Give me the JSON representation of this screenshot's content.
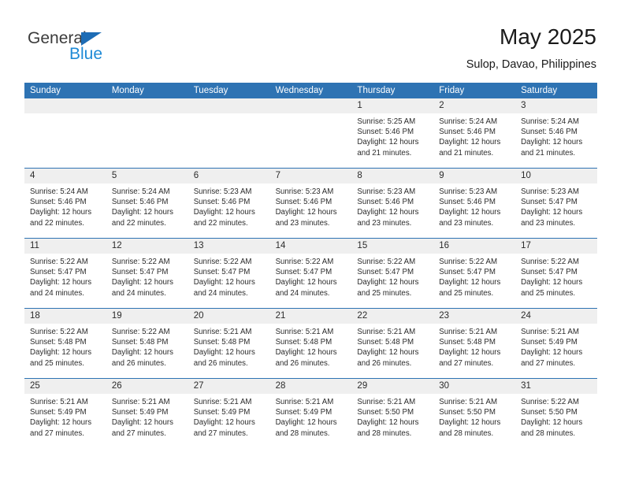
{
  "brand": {
    "name_part1": "General",
    "name_part2": "Blue",
    "triangle_color": "#1d6cb5",
    "blue_color": "#1e8ad6"
  },
  "header": {
    "title": "May 2025",
    "subtitle": "Sulop, Davao, Philippines"
  },
  "colors": {
    "header_blue": "#2e73b3",
    "day_number_bg": "#efefef",
    "text": "#2b2b2b"
  },
  "weekdays": [
    "Sunday",
    "Monday",
    "Tuesday",
    "Wednesday",
    "Thursday",
    "Friday",
    "Saturday"
  ],
  "labels": {
    "sunrise": "Sunrise:",
    "sunset": "Sunset:",
    "daylight": "Daylight:"
  },
  "weeks": [
    [
      {
        "day": "",
        "empty": true
      },
      {
        "day": "",
        "empty": true
      },
      {
        "day": "",
        "empty": true
      },
      {
        "day": "",
        "empty": true
      },
      {
        "day": "1",
        "sunrise": "Sunrise: 5:25 AM",
        "sunset": "Sunset: 5:46 PM",
        "daylight_line1": "Daylight: 12 hours",
        "daylight_line2": "and 21 minutes."
      },
      {
        "day": "2",
        "sunrise": "Sunrise: 5:24 AM",
        "sunset": "Sunset: 5:46 PM",
        "daylight_line1": "Daylight: 12 hours",
        "daylight_line2": "and 21 minutes."
      },
      {
        "day": "3",
        "sunrise": "Sunrise: 5:24 AM",
        "sunset": "Sunset: 5:46 PM",
        "daylight_line1": "Daylight: 12 hours",
        "daylight_line2": "and 21 minutes."
      }
    ],
    [
      {
        "day": "4",
        "sunrise": "Sunrise: 5:24 AM",
        "sunset": "Sunset: 5:46 PM",
        "daylight_line1": "Daylight: 12 hours",
        "daylight_line2": "and 22 minutes."
      },
      {
        "day": "5",
        "sunrise": "Sunrise: 5:24 AM",
        "sunset": "Sunset: 5:46 PM",
        "daylight_line1": "Daylight: 12 hours",
        "daylight_line2": "and 22 minutes."
      },
      {
        "day": "6",
        "sunrise": "Sunrise: 5:23 AM",
        "sunset": "Sunset: 5:46 PM",
        "daylight_line1": "Daylight: 12 hours",
        "daylight_line2": "and 22 minutes."
      },
      {
        "day": "7",
        "sunrise": "Sunrise: 5:23 AM",
        "sunset": "Sunset: 5:46 PM",
        "daylight_line1": "Daylight: 12 hours",
        "daylight_line2": "and 23 minutes."
      },
      {
        "day": "8",
        "sunrise": "Sunrise: 5:23 AM",
        "sunset": "Sunset: 5:46 PM",
        "daylight_line1": "Daylight: 12 hours",
        "daylight_line2": "and 23 minutes."
      },
      {
        "day": "9",
        "sunrise": "Sunrise: 5:23 AM",
        "sunset": "Sunset: 5:46 PM",
        "daylight_line1": "Daylight: 12 hours",
        "daylight_line2": "and 23 minutes."
      },
      {
        "day": "10",
        "sunrise": "Sunrise: 5:23 AM",
        "sunset": "Sunset: 5:47 PM",
        "daylight_line1": "Daylight: 12 hours",
        "daylight_line2": "and 23 minutes."
      }
    ],
    [
      {
        "day": "11",
        "sunrise": "Sunrise: 5:22 AM",
        "sunset": "Sunset: 5:47 PM",
        "daylight_line1": "Daylight: 12 hours",
        "daylight_line2": "and 24 minutes."
      },
      {
        "day": "12",
        "sunrise": "Sunrise: 5:22 AM",
        "sunset": "Sunset: 5:47 PM",
        "daylight_line1": "Daylight: 12 hours",
        "daylight_line2": "and 24 minutes."
      },
      {
        "day": "13",
        "sunrise": "Sunrise: 5:22 AM",
        "sunset": "Sunset: 5:47 PM",
        "daylight_line1": "Daylight: 12 hours",
        "daylight_line2": "and 24 minutes."
      },
      {
        "day": "14",
        "sunrise": "Sunrise: 5:22 AM",
        "sunset": "Sunset: 5:47 PM",
        "daylight_line1": "Daylight: 12 hours",
        "daylight_line2": "and 24 minutes."
      },
      {
        "day": "15",
        "sunrise": "Sunrise: 5:22 AM",
        "sunset": "Sunset: 5:47 PM",
        "daylight_line1": "Daylight: 12 hours",
        "daylight_line2": "and 25 minutes."
      },
      {
        "day": "16",
        "sunrise": "Sunrise: 5:22 AM",
        "sunset": "Sunset: 5:47 PM",
        "daylight_line1": "Daylight: 12 hours",
        "daylight_line2": "and 25 minutes."
      },
      {
        "day": "17",
        "sunrise": "Sunrise: 5:22 AM",
        "sunset": "Sunset: 5:47 PM",
        "daylight_line1": "Daylight: 12 hours",
        "daylight_line2": "and 25 minutes."
      }
    ],
    [
      {
        "day": "18",
        "sunrise": "Sunrise: 5:22 AM",
        "sunset": "Sunset: 5:48 PM",
        "daylight_line1": "Daylight: 12 hours",
        "daylight_line2": "and 25 minutes."
      },
      {
        "day": "19",
        "sunrise": "Sunrise: 5:22 AM",
        "sunset": "Sunset: 5:48 PM",
        "daylight_line1": "Daylight: 12 hours",
        "daylight_line2": "and 26 minutes."
      },
      {
        "day": "20",
        "sunrise": "Sunrise: 5:21 AM",
        "sunset": "Sunset: 5:48 PM",
        "daylight_line1": "Daylight: 12 hours",
        "daylight_line2": "and 26 minutes."
      },
      {
        "day": "21",
        "sunrise": "Sunrise: 5:21 AM",
        "sunset": "Sunset: 5:48 PM",
        "daylight_line1": "Daylight: 12 hours",
        "daylight_line2": "and 26 minutes."
      },
      {
        "day": "22",
        "sunrise": "Sunrise: 5:21 AM",
        "sunset": "Sunset: 5:48 PM",
        "daylight_line1": "Daylight: 12 hours",
        "daylight_line2": "and 26 minutes."
      },
      {
        "day": "23",
        "sunrise": "Sunrise: 5:21 AM",
        "sunset": "Sunset: 5:48 PM",
        "daylight_line1": "Daylight: 12 hours",
        "daylight_line2": "and 27 minutes."
      },
      {
        "day": "24",
        "sunrise": "Sunrise: 5:21 AM",
        "sunset": "Sunset: 5:49 PM",
        "daylight_line1": "Daylight: 12 hours",
        "daylight_line2": "and 27 minutes."
      }
    ],
    [
      {
        "day": "25",
        "sunrise": "Sunrise: 5:21 AM",
        "sunset": "Sunset: 5:49 PM",
        "daylight_line1": "Daylight: 12 hours",
        "daylight_line2": "and 27 minutes."
      },
      {
        "day": "26",
        "sunrise": "Sunrise: 5:21 AM",
        "sunset": "Sunset: 5:49 PM",
        "daylight_line1": "Daylight: 12 hours",
        "daylight_line2": "and 27 minutes."
      },
      {
        "day": "27",
        "sunrise": "Sunrise: 5:21 AM",
        "sunset": "Sunset: 5:49 PM",
        "daylight_line1": "Daylight: 12 hours",
        "daylight_line2": "and 27 minutes."
      },
      {
        "day": "28",
        "sunrise": "Sunrise: 5:21 AM",
        "sunset": "Sunset: 5:49 PM",
        "daylight_line1": "Daylight: 12 hours",
        "daylight_line2": "and 28 minutes."
      },
      {
        "day": "29",
        "sunrise": "Sunrise: 5:21 AM",
        "sunset": "Sunset: 5:50 PM",
        "daylight_line1": "Daylight: 12 hours",
        "daylight_line2": "and 28 minutes."
      },
      {
        "day": "30",
        "sunrise": "Sunrise: 5:21 AM",
        "sunset": "Sunset: 5:50 PM",
        "daylight_line1": "Daylight: 12 hours",
        "daylight_line2": "and 28 minutes."
      },
      {
        "day": "31",
        "sunrise": "Sunrise: 5:22 AM",
        "sunset": "Sunset: 5:50 PM",
        "daylight_line1": "Daylight: 12 hours",
        "daylight_line2": "and 28 minutes."
      }
    ]
  ]
}
